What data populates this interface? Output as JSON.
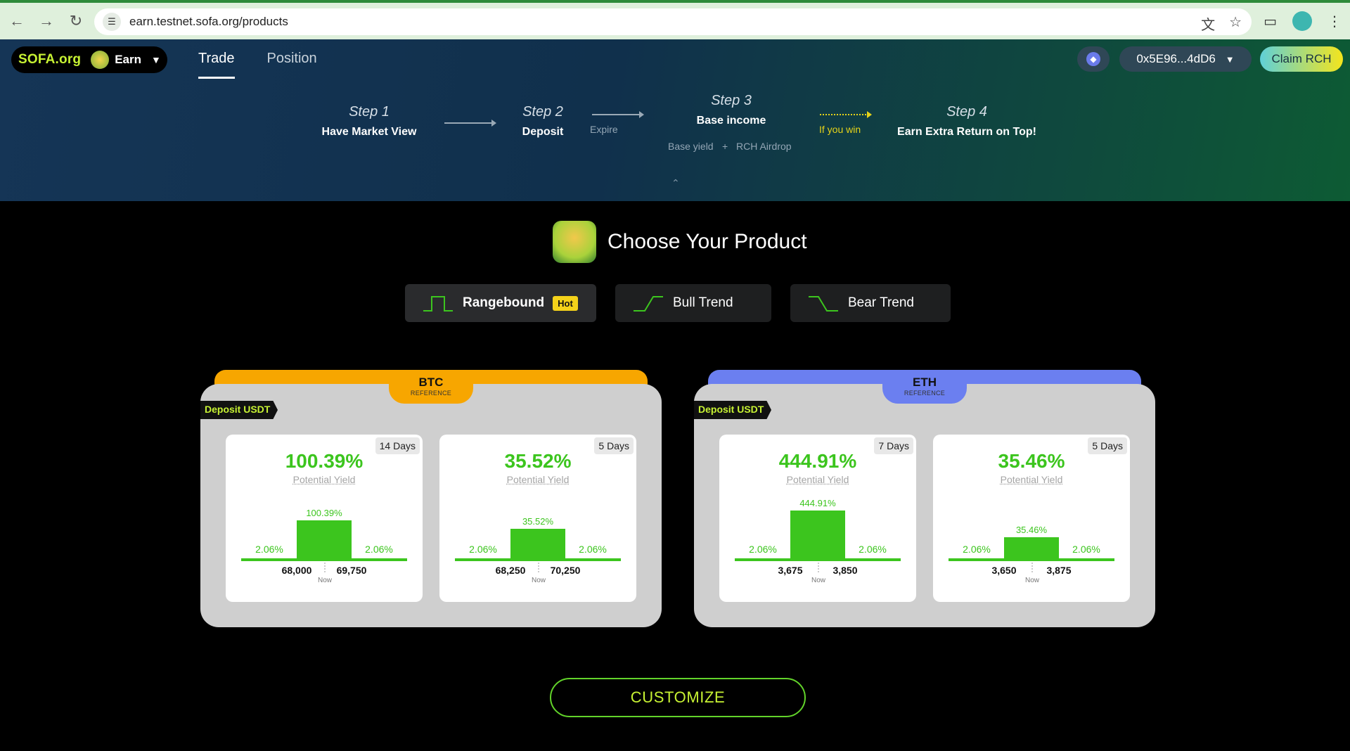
{
  "browser": {
    "url": "earn.testnet.sofa.org/products",
    "icons": [
      "back-icon",
      "forward-icon",
      "reload-icon",
      "site-settings-icon",
      "translate-icon",
      "star-icon",
      "extensions-icon",
      "profile-icon",
      "menu-icon"
    ]
  },
  "header": {
    "brand": "SOFA.org",
    "app": "Earn",
    "tabs": [
      {
        "label": "Trade",
        "active": true
      },
      {
        "label": "Position",
        "active": false
      }
    ],
    "wallet": "0x5E96...4dD6",
    "claim": "Claim  RCH"
  },
  "steps": {
    "s1_title": "Step 1",
    "s1_sub": "Have Market View",
    "s2_title": "Step 2",
    "s2_sub": "Deposit",
    "expire": "Expire",
    "s3_title": "Step 3",
    "s3_sub": "Base income",
    "base_yield": "Base yield",
    "plus": "+",
    "airdrop": "RCH Airdrop",
    "if_win": "If you win",
    "s4_title": "Step 4",
    "s4_sub": "Earn Extra Return on Top!"
  },
  "main": {
    "title": "Choose Your Product",
    "product_tabs": [
      {
        "label": "Rangebound",
        "badge": "Hot",
        "active": true
      },
      {
        "label": "Bull Trend",
        "active": false
      },
      {
        "label": "Bear Trend",
        "active": false
      }
    ],
    "customize": "CUSTOMIZE"
  },
  "panels": [
    {
      "coin": "BTC",
      "ref": "REFERENCE",
      "deposit": "Deposit USDT",
      "color": "#f7a600",
      "cards": [
        {
          "yield": "100.39%",
          "label": "Potential Yield",
          "days": "14 Days",
          "bar": "100.39%",
          "bar_level": 1.0,
          "side_left": "2.06%",
          "side_right": "2.06%",
          "low": "68,000",
          "high": "69,750",
          "now": "Now"
        },
        {
          "yield": "35.52%",
          "label": "Potential Yield",
          "days": "5 Days",
          "bar": "35.52%",
          "bar_level": 0.78,
          "side_left": "2.06%",
          "side_right": "2.06%",
          "low": "68,250",
          "high": "70,250",
          "now": "Now"
        }
      ]
    },
    {
      "coin": "ETH",
      "ref": "REFERENCE",
      "deposit": "Deposit USDT",
      "color": "#6b7ff0",
      "cards": [
        {
          "yield": "444.91%",
          "label": "Potential Yield",
          "days": "7 Days",
          "bar": "444.91%",
          "bar_level": 1.25,
          "side_left": "2.06%",
          "side_right": "2.06%",
          "low": "3,675",
          "high": "3,850",
          "now": "Now"
        },
        {
          "yield": "35.46%",
          "label": "Potential Yield",
          "days": "5 Days",
          "bar": "35.46%",
          "bar_level": 0.55,
          "side_left": "2.06%",
          "side_right": "2.06%",
          "low": "3,650",
          "high": "3,875",
          "now": "Now"
        }
      ]
    }
  ],
  "colors": {
    "accent_green": "#3cc51e",
    "lime": "#c7f233",
    "hot_badge": "#f4d21a"
  }
}
